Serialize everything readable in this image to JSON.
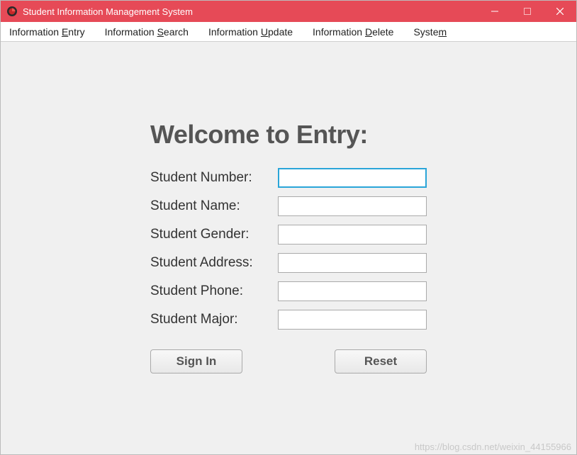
{
  "titlebar": {
    "title": "Student Information Management System"
  },
  "menubar": {
    "items": [
      {
        "pre": "Information ",
        "hot": "E",
        "post": "ntry"
      },
      {
        "pre": "Information ",
        "hot": "S",
        "post": "earch"
      },
      {
        "pre": "Information ",
        "hot": "U",
        "post": "pdate"
      },
      {
        "pre": "Information ",
        "hot": "D",
        "post": "elete"
      },
      {
        "pre": "Syste",
        "hot": "m",
        "post": ""
      }
    ]
  },
  "form": {
    "heading": "Welcome to Entry:",
    "fields": {
      "number": {
        "label": "Student Number:",
        "value": ""
      },
      "name": {
        "label": "Student Name:",
        "value": ""
      },
      "gender": {
        "label": "Student Gender:",
        "value": ""
      },
      "address": {
        "label": "Student Address:",
        "value": ""
      },
      "phone": {
        "label": "Student Phone:",
        "value": ""
      },
      "major": {
        "label": "Student Major:",
        "value": ""
      }
    },
    "buttons": {
      "signin": "Sign In",
      "reset": "Reset"
    }
  },
  "watermark": "https://blog.csdn.net/weixin_44155966"
}
